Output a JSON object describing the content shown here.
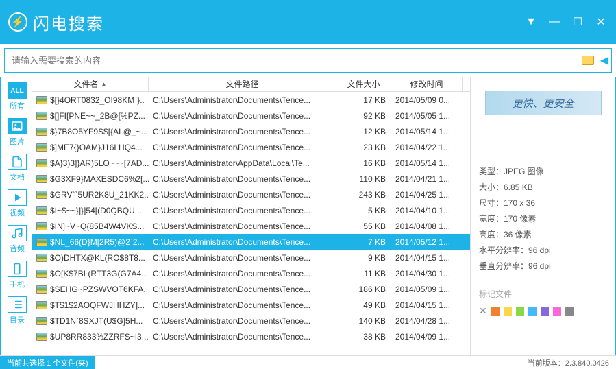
{
  "app": {
    "title": "闪电搜索"
  },
  "search": {
    "placeholder": "请输入需要搜索的内容"
  },
  "sidebar": {
    "items": [
      {
        "label": "所有",
        "icon": "ALL"
      },
      {
        "label": "图片",
        "icon": "image"
      },
      {
        "label": "文档",
        "icon": "doc"
      },
      {
        "label": "视频",
        "icon": "video"
      },
      {
        "label": "音频",
        "icon": "audio"
      },
      {
        "label": "手机",
        "icon": "phone"
      },
      {
        "label": "目录",
        "icon": "folder"
      }
    ]
  },
  "columns": {
    "name": "文件名",
    "path": "文件路径",
    "size": "文件大小",
    "date": "修改时间"
  },
  "files": [
    {
      "name": "$[}4ORT0832_OI98KM`}..",
      "path": "C:\\Users\\Administrator\\Documents\\Tence...",
      "size": "17 KB",
      "date": "2014/05/09 0..."
    },
    {
      "name": "$[]FI[PNE~~_2B@[%PZ...",
      "path": "C:\\Users\\Administrator\\Documents\\Tence...",
      "size": "92 KB",
      "date": "2014/05/05 1..."
    },
    {
      "name": "$}7B8O5YF9S$[{AL@_~...",
      "path": "C:\\Users\\Administrator\\Documents\\Tence...",
      "size": "12 KB",
      "date": "2014/05/14 1..."
    },
    {
      "name": "$]ME7{}OAM}J16LHQ4...",
      "path": "C:\\Users\\Administrator\\Documents\\Tence...",
      "size": "23 KB",
      "date": "2014/04/22 1..."
    },
    {
      "name": "$A}3)3]}AR)5LO~~~[7AD...",
      "path": "C:\\Users\\Administrator\\AppData\\Local\\Te...",
      "size": "16 KB",
      "date": "2014/05/14 1..."
    },
    {
      "name": "$G3XF9}MAXESDC6%2[...",
      "path": "C:\\Users\\Administrator\\Documents\\Tence...",
      "size": "110 KB",
      "date": "2014/04/21 1..."
    },
    {
      "name": "$GRV``5UR2K8U_21KK2...",
      "path": "C:\\Users\\Administrator\\Documents\\Tence...",
      "size": "243 KB",
      "date": "2014/04/25 1..."
    },
    {
      "name": "$I~$~~}]}]54[(D0QBQU...",
      "path": "C:\\Users\\Administrator\\Documents\\Tence...",
      "size": "5 KB",
      "date": "2014/04/10 1..."
    },
    {
      "name": "$IN]~V~Q{85B4W4VKS...",
      "path": "C:\\Users\\Administrator\\Documents\\Tence...",
      "size": "55 KB",
      "date": "2014/04/08 1..."
    },
    {
      "name": "$NL_66(D}M[2R5)@2`2...",
      "path": "C:\\Users\\Administrator\\Documents\\Tence...",
      "size": "7 KB",
      "date": "2014/05/12 1...",
      "selected": true
    },
    {
      "name": "$O)DHTX@KL(RO$8T8...",
      "path": "C:\\Users\\Administrator\\Documents\\Tence...",
      "size": "9 KB",
      "date": "2014/04/15 1..."
    },
    {
      "name": "$O[K$7BL(RTT3G(G7A4...",
      "path": "C:\\Users\\Administrator\\Documents\\Tence...",
      "size": "11 KB",
      "date": "2014/04/30 1..."
    },
    {
      "name": "$SEHG~PZSWVOT6KFA...",
      "path": "C:\\Users\\Administrator\\Documents\\Tence...",
      "size": "186 KB",
      "date": "2014/05/09 1..."
    },
    {
      "name": "$T$1$2AOQFWJHHZY]...",
      "path": "C:\\Users\\Administrator\\Documents\\Tence...",
      "size": "49 KB",
      "date": "2014/04/15 1..."
    },
    {
      "name": "$TD1N`8SXJT(U$G]5H...",
      "path": "C:\\Users\\Administrator\\Documents\\Tence...",
      "size": "140 KB",
      "date": "2014/04/28 1..."
    },
    {
      "name": "$UP8RR833%ZZRFS~I3...",
      "path": "C:\\Users\\Administrator\\Documents\\Tence...",
      "size": "38 KB",
      "date": "2014/04/09 1..."
    }
  ],
  "preview": {
    "banner_text": "更快、更安全",
    "meta": [
      "类型：JPEG 图像",
      "大小：6.85 KB",
      "尺寸：170 x 36",
      "宽度：170 像素",
      "高度：36 像素",
      "水平分辨率：96 dpi",
      "垂直分辨率：96 dpi"
    ],
    "tag_label": "标记文件",
    "colors": [
      "#f08030",
      "#f8d848",
      "#88d848",
      "#48b8f8",
      "#8868d8",
      "#f868d8",
      "#888888"
    ]
  },
  "status": {
    "left": "当前共选择 1 个文件(夹)",
    "right": "当前版本：2.3.840.0426"
  }
}
